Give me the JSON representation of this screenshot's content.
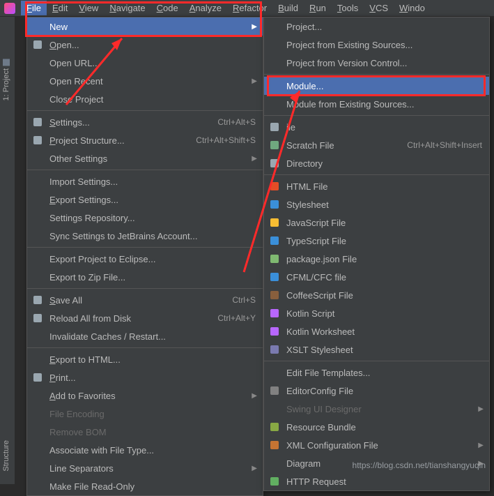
{
  "menubar": [
    "File",
    "Edit",
    "View",
    "Navigate",
    "Code",
    "Analyze",
    "Refactor",
    "Build",
    "Run",
    "Tools",
    "VCS",
    "Windo"
  ],
  "menubar_open_index": 0,
  "side_tabs": {
    "project": "1: Project",
    "structure": "Structure"
  },
  "file_menu": [
    {
      "t": "item",
      "icon": "",
      "label": "New",
      "arrow": true,
      "hover": true
    },
    {
      "t": "item",
      "icon": "folder",
      "label": "Open...",
      "u": true
    },
    {
      "t": "item",
      "icon": "",
      "label": "Open URL..."
    },
    {
      "t": "item",
      "icon": "",
      "label": "Open Recent",
      "arrow": true
    },
    {
      "t": "item",
      "icon": "",
      "label": "Close Project"
    },
    {
      "t": "sep"
    },
    {
      "t": "item",
      "icon": "wrench",
      "label": "Settings...",
      "sc": "Ctrl+Alt+S",
      "u": true
    },
    {
      "t": "item",
      "icon": "struct",
      "label": "Project Structure...",
      "sc": "Ctrl+Alt+Shift+S",
      "u": true
    },
    {
      "t": "item",
      "icon": "",
      "label": "Other Settings",
      "arrow": true
    },
    {
      "t": "sep"
    },
    {
      "t": "item",
      "icon": "",
      "label": "Import Settings..."
    },
    {
      "t": "item",
      "icon": "",
      "label": "Export Settings...",
      "u": true
    },
    {
      "t": "item",
      "icon": "",
      "label": "Settings Repository..."
    },
    {
      "t": "item",
      "icon": "",
      "label": "Sync Settings to JetBrains Account..."
    },
    {
      "t": "sep"
    },
    {
      "t": "item",
      "icon": "",
      "label": "Export Project to Eclipse..."
    },
    {
      "t": "item",
      "icon": "",
      "label": "Export to Zip File..."
    },
    {
      "t": "sep"
    },
    {
      "t": "item",
      "icon": "save",
      "label": "Save All",
      "sc": "Ctrl+S",
      "u": true
    },
    {
      "t": "item",
      "icon": "reload",
      "label": "Reload All from Disk",
      "sc": "Ctrl+Alt+Y"
    },
    {
      "t": "item",
      "icon": "",
      "label": "Invalidate Caches / Restart..."
    },
    {
      "t": "sep"
    },
    {
      "t": "item",
      "icon": "",
      "label": "Export to HTML...",
      "u": true
    },
    {
      "t": "item",
      "icon": "print",
      "label": "Print...",
      "u": true
    },
    {
      "t": "item",
      "icon": "",
      "label": "Add to Favorites",
      "arrow": true,
      "u": true
    },
    {
      "t": "item",
      "icon": "",
      "label": "File Encoding",
      "disabled": true
    },
    {
      "t": "item",
      "icon": "",
      "label": "Remove BOM",
      "disabled": true
    },
    {
      "t": "item",
      "icon": "",
      "label": "Associate with File Type..."
    },
    {
      "t": "item",
      "icon": "",
      "label": "Line Separators",
      "arrow": true
    },
    {
      "t": "item",
      "icon": "",
      "label": "Make File Read-Only"
    }
  ],
  "new_menu": [
    {
      "t": "item",
      "icon": "",
      "label": "Project..."
    },
    {
      "t": "item",
      "icon": "",
      "label": "Project from Existing Sources..."
    },
    {
      "t": "item",
      "icon": "",
      "label": "Project from Version Control..."
    },
    {
      "t": "sep"
    },
    {
      "t": "item",
      "icon": "",
      "label": "Module...",
      "hover": true
    },
    {
      "t": "item",
      "icon": "",
      "label": "Module from Existing Sources..."
    },
    {
      "t": "sep"
    },
    {
      "t": "item",
      "icon": "file",
      "label": "ile"
    },
    {
      "t": "item",
      "icon": "scratch",
      "label": "Scratch File",
      "sc": "Ctrl+Alt+Shift+Insert"
    },
    {
      "t": "item",
      "icon": "dir",
      "label": "Directory"
    },
    {
      "t": "sep"
    },
    {
      "t": "item",
      "icon": "html",
      "label": "HTML File"
    },
    {
      "t": "item",
      "icon": "css",
      "label": "Stylesheet"
    },
    {
      "t": "item",
      "icon": "js",
      "label": "JavaScript File"
    },
    {
      "t": "item",
      "icon": "ts",
      "label": "TypeScript File"
    },
    {
      "t": "item",
      "icon": "pkg",
      "label": "package.json File"
    },
    {
      "t": "item",
      "icon": "cfml",
      "label": "CFML/CFC file"
    },
    {
      "t": "item",
      "icon": "coffee",
      "label": "CoffeeScript File"
    },
    {
      "t": "item",
      "icon": "kt",
      "label": "Kotlin Script"
    },
    {
      "t": "item",
      "icon": "kt",
      "label": "Kotlin Worksheet"
    },
    {
      "t": "item",
      "icon": "xslt",
      "label": "XSLT Stylesheet"
    },
    {
      "t": "sep"
    },
    {
      "t": "item",
      "icon": "",
      "label": "Edit File Templates..."
    },
    {
      "t": "item",
      "icon": "ec",
      "label": "EditorConfig File"
    },
    {
      "t": "item",
      "icon": "",
      "label": "Swing UI Designer",
      "arrow": true,
      "disabled": true
    },
    {
      "t": "item",
      "icon": "rb",
      "label": "Resource Bundle"
    },
    {
      "t": "item",
      "icon": "xml",
      "label": "XML Configuration File",
      "arrow": true
    },
    {
      "t": "item",
      "icon": "",
      "label": "Diagram",
      "arrow": true
    },
    {
      "t": "item",
      "icon": "http",
      "label": "HTTP Request"
    }
  ],
  "watermark": "https://blog.csdn.net/tianshangyuqin"
}
